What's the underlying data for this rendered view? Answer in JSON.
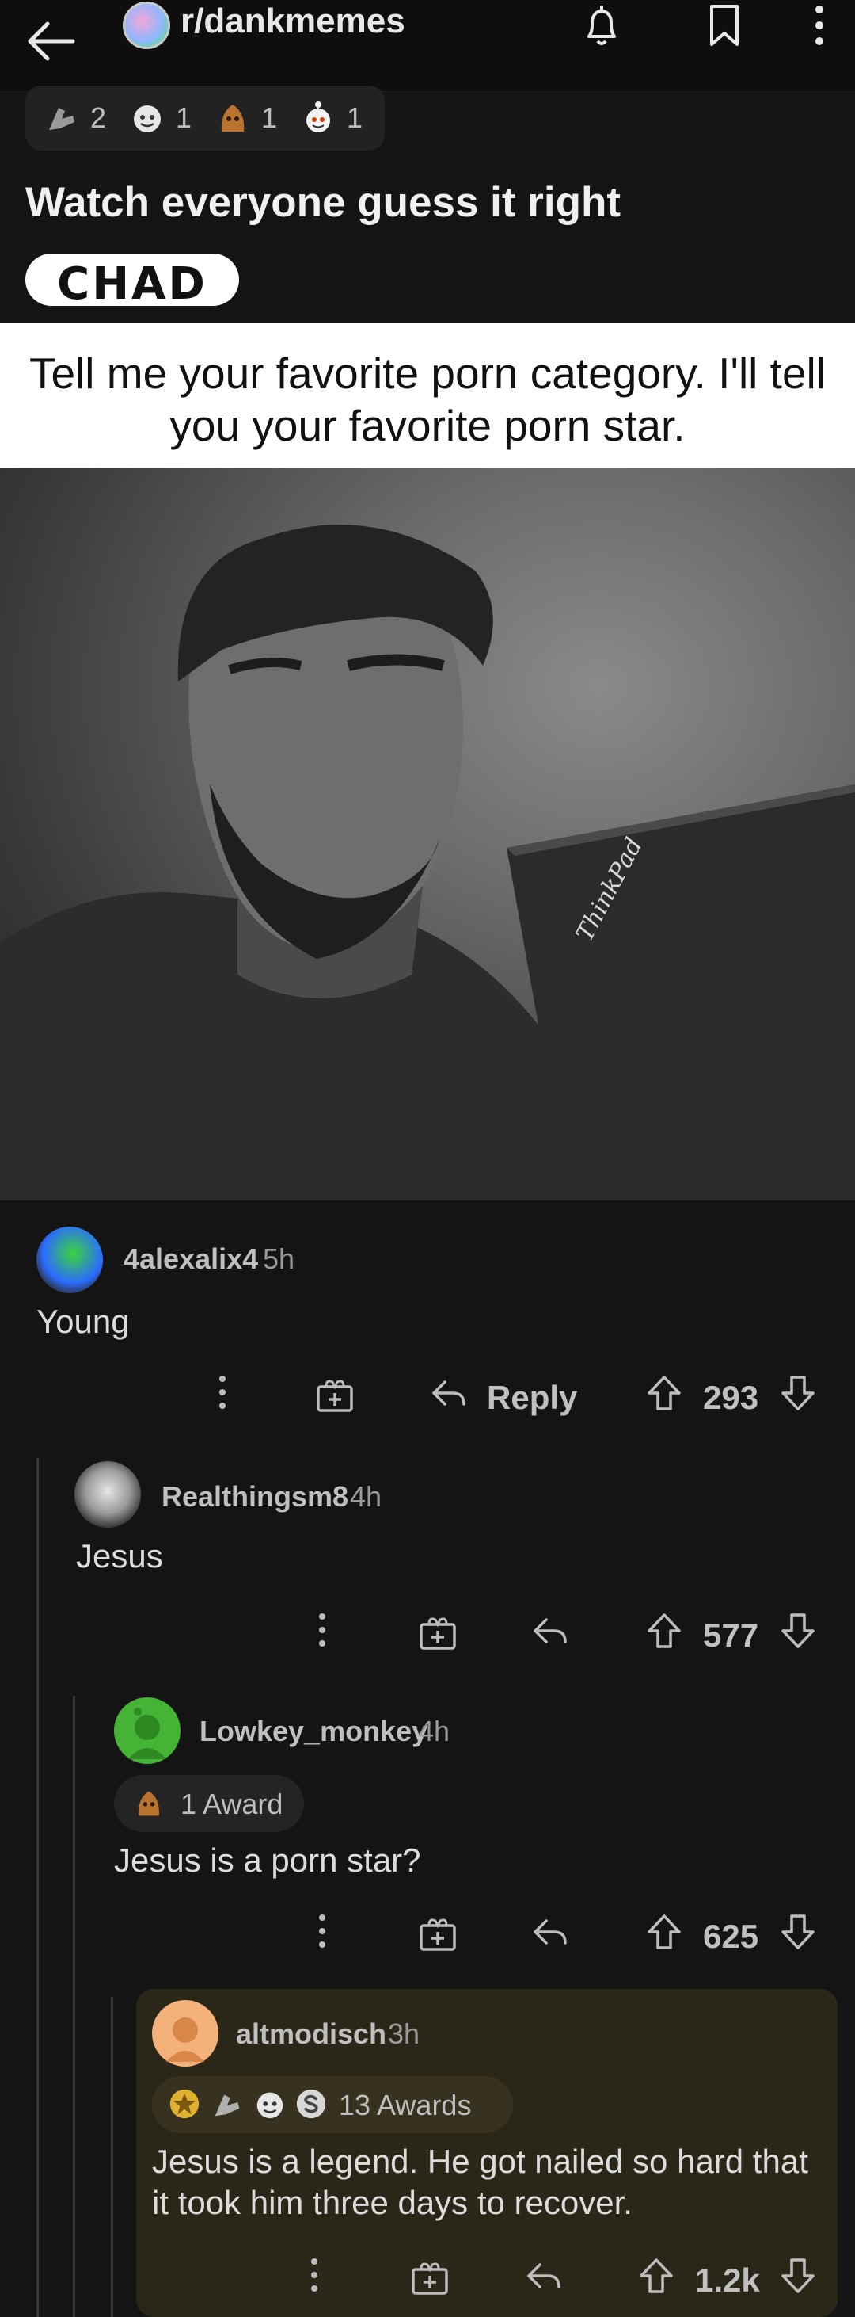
{
  "header": {
    "subreddit": "r/dankmemes",
    "icons": [
      "back-arrow-icon",
      "bell-icon",
      "bookmark-icon",
      "more-vertical-icon"
    ]
  },
  "post": {
    "awards": [
      {
        "icon": "award-icon-1",
        "count": "2"
      },
      {
        "icon": "award-icon-2",
        "count": "1"
      },
      {
        "icon": "award-icon-3",
        "count": "1"
      },
      {
        "icon": "award-icon-4",
        "count": "1"
      }
    ],
    "title": "Watch everyone guess it right",
    "flair": "CHAD",
    "meme_caption": "Tell me your favorite porn category.  I'll tell you your favorite porn star.",
    "laptop_brand": "ThinkPad"
  },
  "comments": [
    {
      "username": "4alexalix4",
      "time": "5h",
      "body": "Young",
      "reply_label": "Reply",
      "score": "293"
    },
    {
      "username": "Realthingsm8",
      "time": "4h",
      "body": "Jesus",
      "score": "577"
    },
    {
      "username": "Lowkey_monkey",
      "time": "4h",
      "awards_label": "1 Award",
      "body": "Jesus is a porn star?",
      "score": "625"
    },
    {
      "username": "altmodisch",
      "time": "3h",
      "awards_label": "13 Awards",
      "body": "Jesus is a legend. He got nailed so hard that it took him three days to recover.",
      "score": "1.2k"
    }
  ],
  "colors": {
    "background": "#141414",
    "highlight": "#2b2718",
    "text": "#d7d7d7"
  }
}
